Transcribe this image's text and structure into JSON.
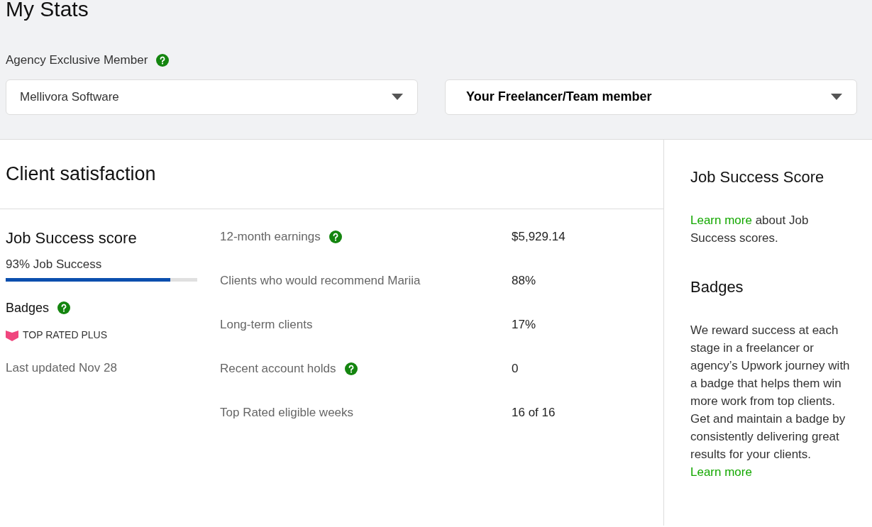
{
  "page_title": "My Stats",
  "member_label": {
    "text": "Agency Exclusive Member",
    "help": true
  },
  "selects": [
    {
      "value": "Mellivora Software",
      "bold": false
    },
    {
      "value": "Your Freelancer/Team member",
      "bold": true
    }
  ],
  "section_title": "Client satisfaction",
  "job_success": {
    "title": "Job Success score",
    "reading": "93% Job Success",
    "level": 0.86
  },
  "badges": {
    "title": "Badges",
    "help": true,
    "badge": "TOP RATED PLUS",
    "updated": "Last updated Nov 28"
  },
  "stats": [
    {
      "label": "12-month earnings",
      "help": true,
      "value": "$5,929.14"
    },
    {
      "label": "Clients who would recommend Mariia",
      "help": false,
      "value": "88%"
    },
    {
      "label": "Long-term clients",
      "help": false,
      "value": "17%"
    },
    {
      "label": "Recent account holds",
      "help": true,
      "value": "0"
    },
    {
      "label": "Top Rated eligible weeks",
      "help": false,
      "value": "16 of 16"
    }
  ],
  "sidebar": [
    {
      "title": "Job Success Score",
      "link": "Learn more",
      "after": " about Job Success scores."
    },
    {
      "title": "Badges",
      "before": "We reward success at each stage in a freelancer or agency’s Upwork journey with a badge that helps them win more work from top clients. Get and maintain a badge by consistently delivering great results for your clients. ",
      "link": "Learn more"
    }
  ]
}
